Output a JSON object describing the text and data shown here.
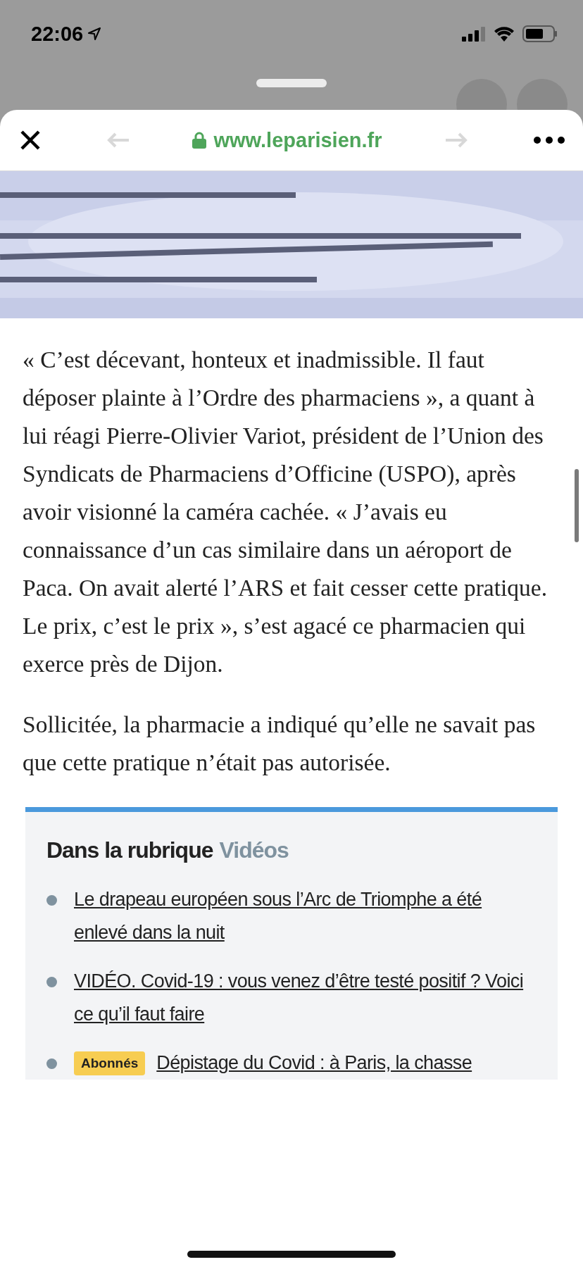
{
  "status_bar": {
    "time": "22:06"
  },
  "browser": {
    "url": "www.leparisien.fr",
    "back_enabled": false,
    "forward_enabled": false
  },
  "article": {
    "paragraphs": [
      "« C’est décevant, honteux et inadmissible. Il faut déposer plainte à l’Ordre des pharmaciens », a quant à lui réagi Pierre-Olivier Variot, président de l’Union des Syndicats de Pharmaciens d’Officine (USPO), après avoir visionné la caméra cachée. « J’avais eu connaissance d’un cas similaire dans un aéroport de Paca. On avait alerté l’ARS et fait cesser cette pratique. Le prix, c’est le prix », s’est agacé ce pharmacien qui exerce près de Dijon.",
      "Sollicitée, la pharmacie a indiqué qu’elle ne savait pas que cette pratique n’était pas autorisée."
    ]
  },
  "related": {
    "title": "Dans la rubrique",
    "section": "Vidéos",
    "items": [
      {
        "title": "Le drapeau européen sous l’Arc de Triomphe a été enlevé dans la nuit"
      },
      {
        "title": "VIDÉO. Covid-19 : vous venez d’être testé positif ? Voici ce qu’il faut faire"
      },
      {
        "badge": "Abonnés",
        "title": "Dépistage du Covid : à Paris, la chasse"
      }
    ]
  }
}
